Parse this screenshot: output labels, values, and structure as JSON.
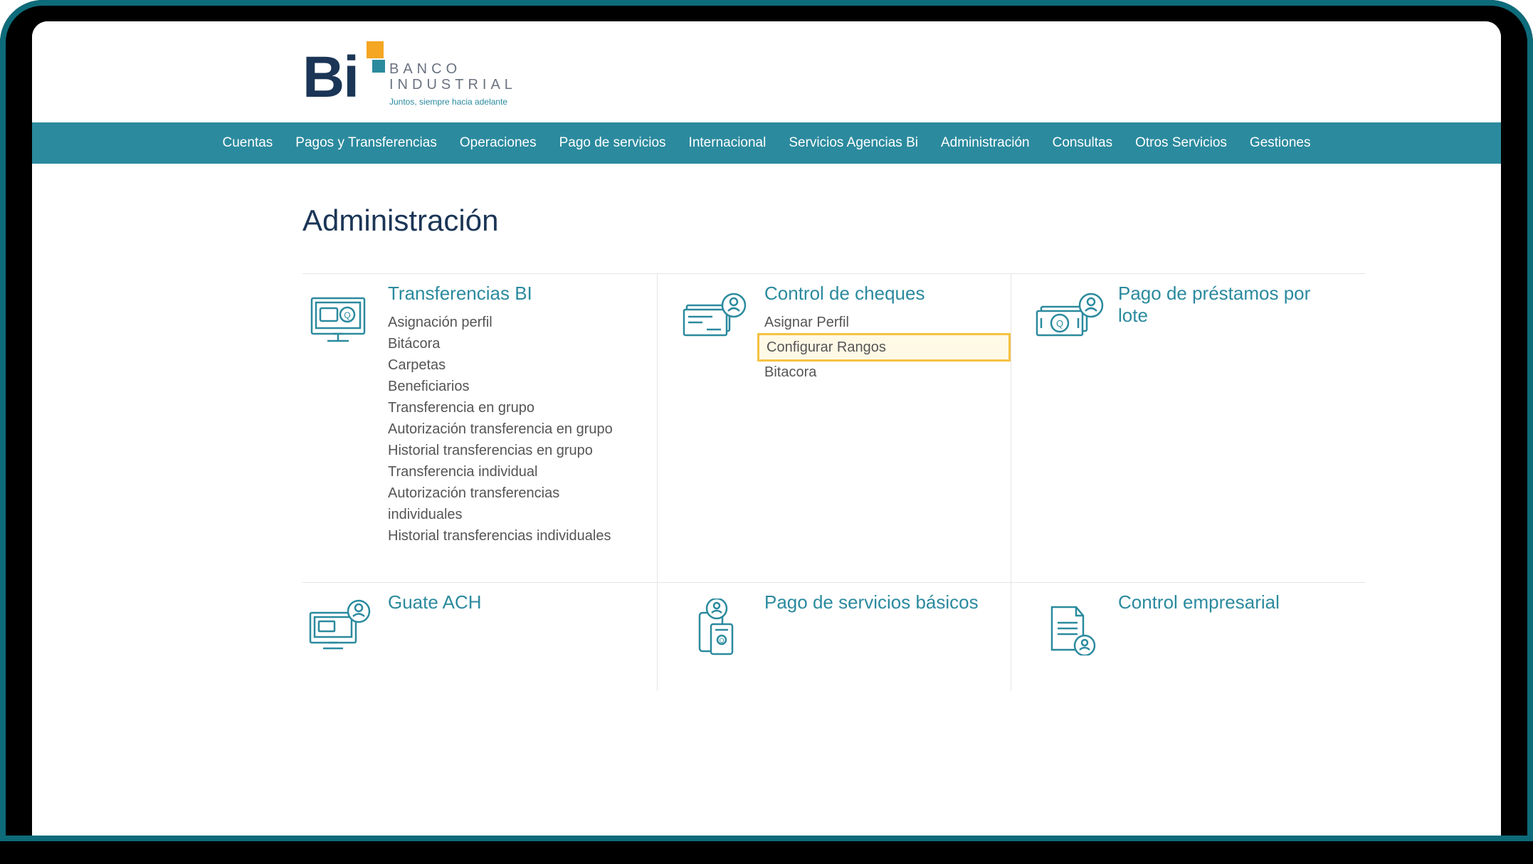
{
  "brand": {
    "name_line1": "BANCO",
    "name_line2": "INDUSTRIAL",
    "tagline": "Juntos, siempre hacia adelante"
  },
  "nav": [
    "Cuentas",
    "Pagos y Transferencias",
    "Operaciones",
    "Pago de servicios",
    "Internacional",
    "Servicios Agencias Bi",
    "Administración",
    "Consultas",
    "Otros Servicios",
    "Gestiones"
  ],
  "page_title": "Administración",
  "cards": {
    "transferencias_bi": {
      "title": "Transferencias BI",
      "links": [
        "Asignación perfil",
        "Bitácora",
        "Carpetas",
        "Beneficiarios",
        "Transferencia en grupo",
        "Autorización transferencia en grupo",
        "Historial transferencias en grupo",
        "Transferencia individual",
        "Autorización transferencias individuales",
        "Historial transferencias individuales"
      ]
    },
    "control_cheques": {
      "title": "Control de cheques",
      "links": [
        "Asignar Perfil",
        "Configurar Rangos",
        "Bitacora"
      ],
      "highlighted_index": 1
    },
    "pago_prestamos": {
      "title": "Pago de préstamos por lote"
    },
    "guate_ach": {
      "title": "Guate ACH"
    },
    "pago_servicios": {
      "title": "Pago de servicios básicos"
    },
    "control_empresarial": {
      "title": "Control empresarial"
    }
  }
}
